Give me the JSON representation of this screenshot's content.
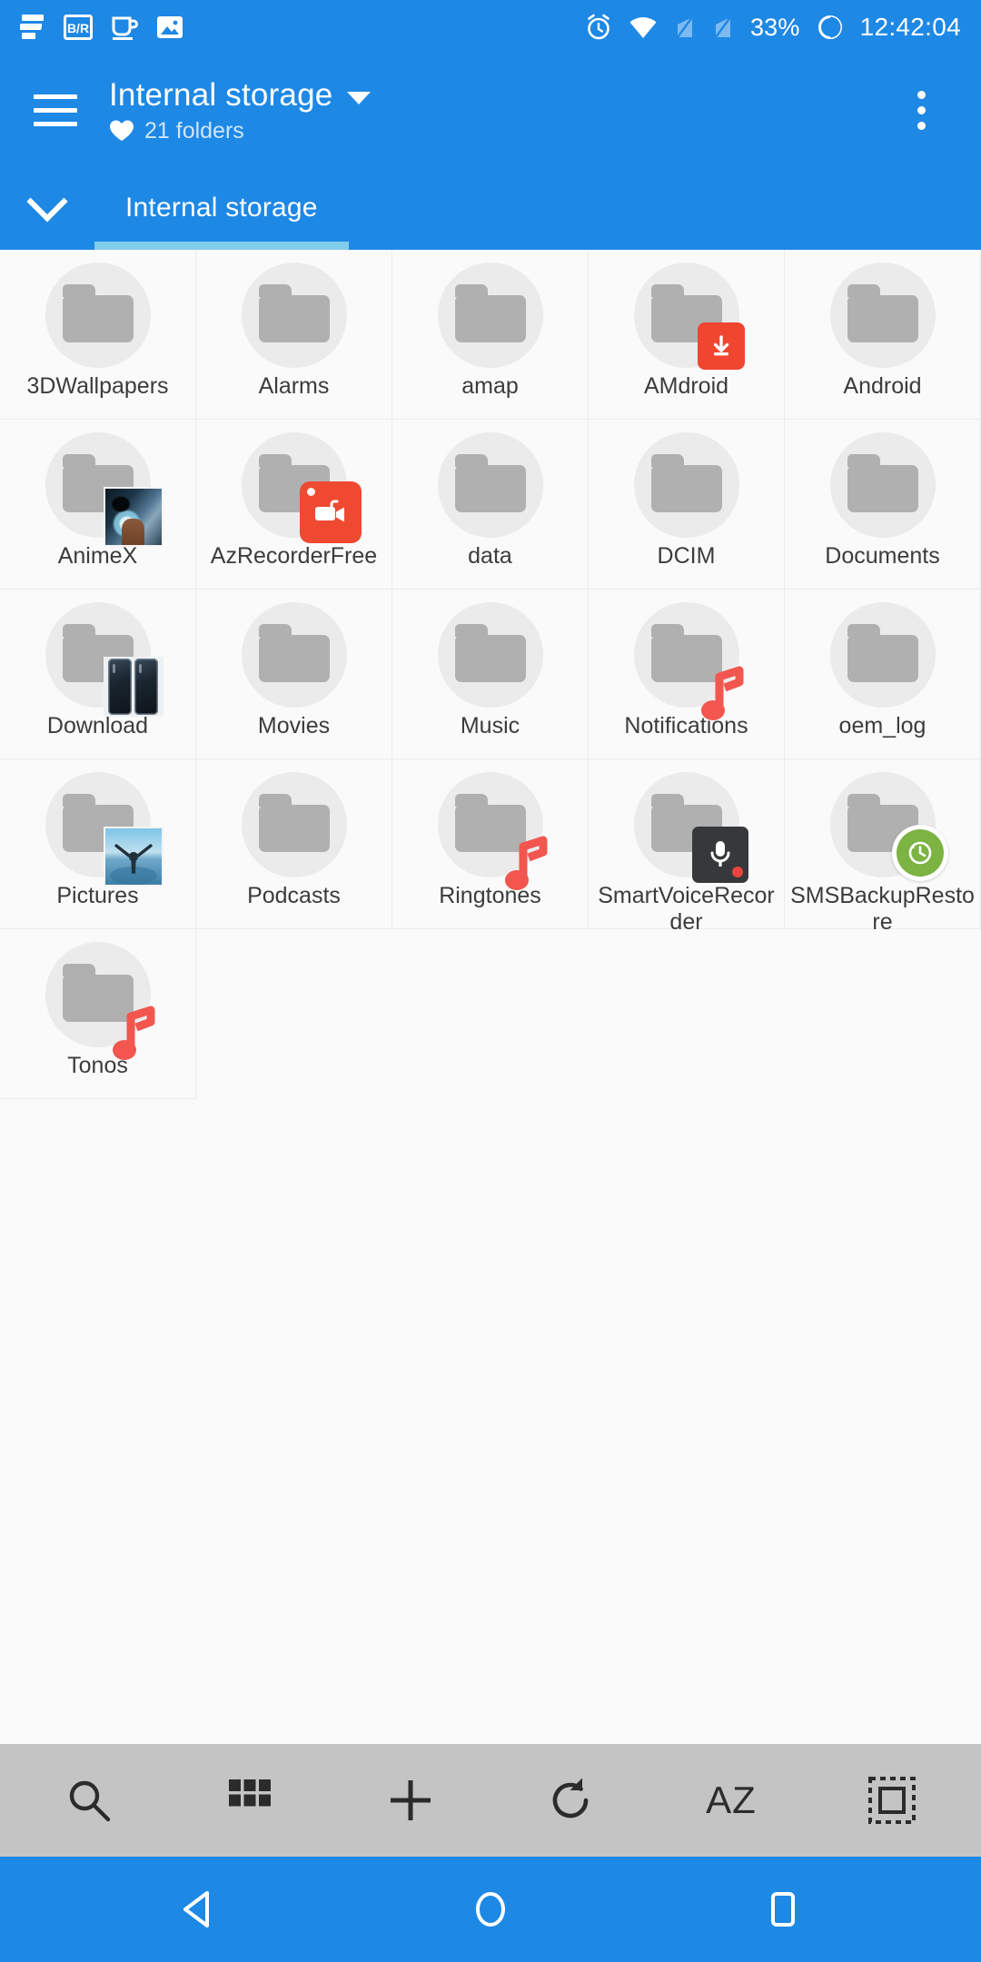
{
  "status_bar": {
    "notification_icons": [
      "evernote-icon",
      "br-box-icon",
      "coffee-cup-icon",
      "image-icon"
    ],
    "system_icons": [
      "alarm-icon",
      "wifi-icon",
      "sim1-signal-icon",
      "sim2-signal-icon",
      "battery-circle-icon"
    ],
    "battery_percent": "33%",
    "time": "12:42:04"
  },
  "app_bar": {
    "menu_icon": "hamburger-menu-icon",
    "title": "Internal storage",
    "title_caret_icon": "caret-down-icon",
    "favorite_icon": "heart-icon",
    "subtitle": "21 folders",
    "overflow_icon": "overflow-menu-icon"
  },
  "breadcrumb": {
    "expand_icon": "chevron-down-icon",
    "tabs": [
      {
        "label": "Internal storage",
        "active": true
      }
    ]
  },
  "grid": {
    "items": [
      {
        "name": "3DWallpapers",
        "badge": "none"
      },
      {
        "name": "Alarms",
        "badge": "none"
      },
      {
        "name": "amap",
        "badge": "none"
      },
      {
        "name": "AMdroid",
        "badge": "download-icon"
      },
      {
        "name": "Android",
        "badge": "none"
      },
      {
        "name": "AnimeX",
        "badge": "image-thumbnail"
      },
      {
        "name": "AzRecorderFree",
        "badge": "video-camera-icon"
      },
      {
        "name": "data",
        "badge": "none"
      },
      {
        "name": "DCIM",
        "badge": "none"
      },
      {
        "name": "Documents",
        "badge": "none"
      },
      {
        "name": "Download",
        "badge": "phone-thumbnail"
      },
      {
        "name": "Movies",
        "badge": "none"
      },
      {
        "name": "Music",
        "badge": "none"
      },
      {
        "name": "Notifications",
        "badge": "music-note-icon"
      },
      {
        "name": "oem_log",
        "badge": "none"
      },
      {
        "name": "Pictures",
        "badge": "image-thumbnail"
      },
      {
        "name": "Podcasts",
        "badge": "none"
      },
      {
        "name": "Ringtones",
        "badge": "music-note-icon"
      },
      {
        "name": "SmartVoiceRecorder",
        "badge": "microphone-icon"
      },
      {
        "name": "SMSBackupRestore",
        "badge": "history-clock-icon"
      },
      {
        "name": "Tonos",
        "badge": "music-note-icon"
      }
    ]
  },
  "toolbar": {
    "buttons": [
      {
        "name": "search",
        "icon": "search-icon"
      },
      {
        "name": "view-mode",
        "icon": "grid-view-icon"
      },
      {
        "name": "add",
        "icon": "plus-icon"
      },
      {
        "name": "refresh",
        "icon": "refresh-icon"
      },
      {
        "name": "sort",
        "icon": "az-sort-icon",
        "label": "AZ"
      },
      {
        "name": "select-all",
        "icon": "select-all-icon"
      }
    ]
  },
  "nav_bar": {
    "buttons": [
      {
        "name": "back",
        "icon": "triangle-back-icon"
      },
      {
        "name": "home",
        "icon": "circle-home-icon"
      },
      {
        "name": "recents",
        "icon": "square-recents-icon"
      }
    ]
  },
  "colors": {
    "primary": "#1e88e5",
    "tab_indicator": "#7fcdea",
    "page_bg": "#fafafa",
    "toolbar_bg": "#c4c4c4",
    "folder_gray": "#b0b0b0",
    "accent_red": "#ef4a31"
  }
}
